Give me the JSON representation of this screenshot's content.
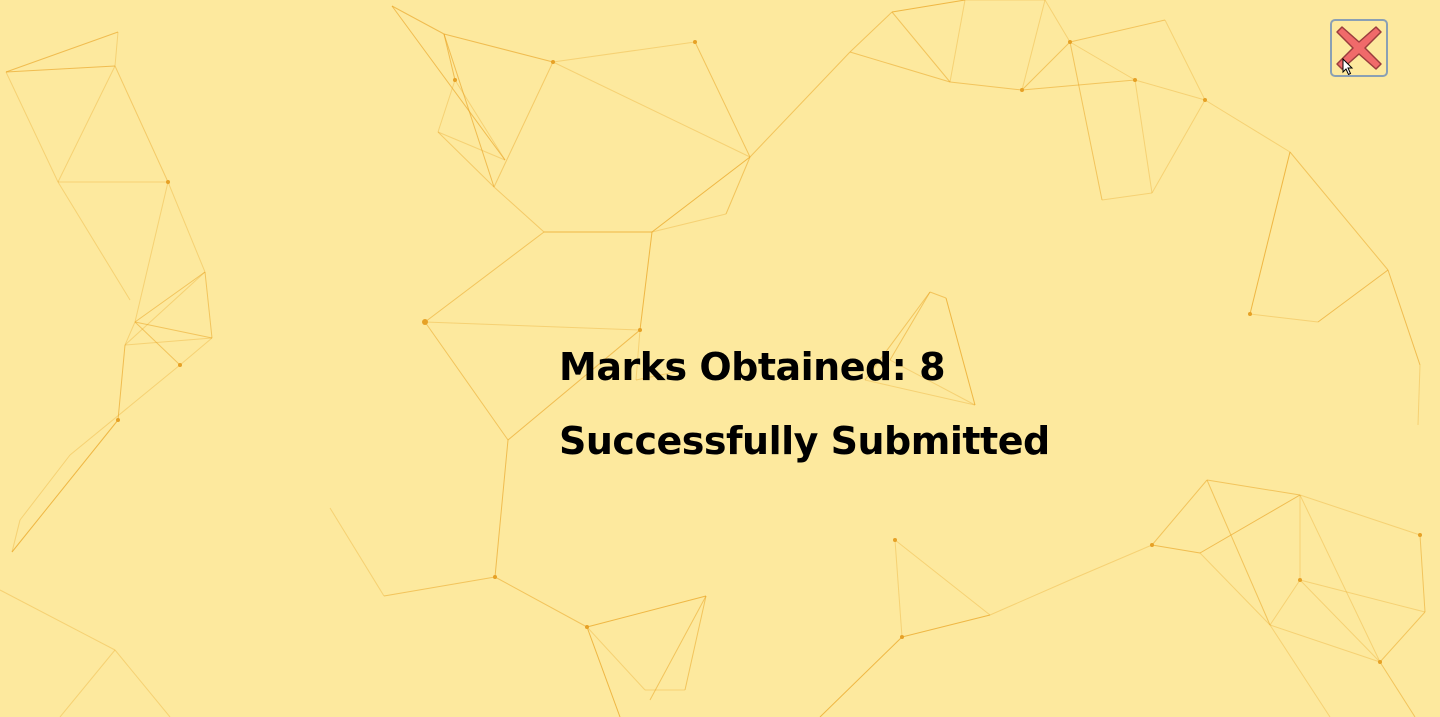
{
  "result": {
    "marks_label": "Marks Obtained: 8",
    "status_label": "Successfully Submitted"
  },
  "close_button": {
    "icon": "close-icon",
    "color": "#f06a6a"
  },
  "background": {
    "color": "#fde99e",
    "pattern": "network-lines",
    "line_color": "#e9a526"
  }
}
